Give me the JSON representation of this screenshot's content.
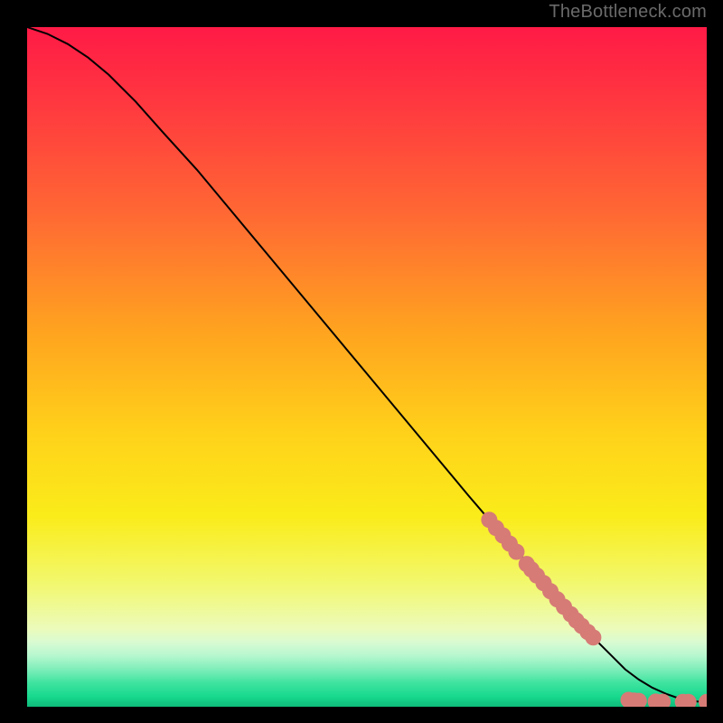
{
  "attribution": "TheBottleneck.com",
  "chart_data": {
    "type": "line",
    "title": "",
    "xlabel": "",
    "ylabel": "",
    "xlim": [
      0,
      100
    ],
    "ylim": [
      0,
      100
    ],
    "grid": false,
    "legend": false,
    "series": [
      {
        "name": "curve",
        "style": "line",
        "color": "#000000",
        "x": [
          0,
          3,
          6,
          9,
          12,
          16,
          20,
          25,
          30,
          35,
          40,
          45,
          50,
          55,
          60,
          65,
          68,
          72,
          76,
          80,
          83,
          86,
          88,
          90,
          92,
          94,
          96,
          98,
          100
        ],
        "y": [
          100,
          99,
          97.5,
          95.5,
          93,
          89,
          84.5,
          79,
          73,
          67,
          61,
          55,
          49,
          43,
          37,
          31,
          27.5,
          23,
          18.5,
          14,
          10.5,
          7.5,
          5.5,
          4,
          2.8,
          1.9,
          1.2,
          0.8,
          0.7
        ]
      },
      {
        "name": "upper-marker-cluster",
        "style": "points",
        "color": "#d67b76",
        "x": [
          68.0,
          69.0,
          70.0,
          71.0,
          72.0,
          73.5,
          74.2,
          75.0,
          76.0,
          77.0,
          78.0,
          79.0,
          80.0,
          80.8,
          81.6,
          82.5,
          83.3
        ],
        "y": [
          27.5,
          26.3,
          25.2,
          24.0,
          22.8,
          21.0,
          20.2,
          19.3,
          18.2,
          17.0,
          15.8,
          14.7,
          13.6,
          12.7,
          11.9,
          11.0,
          10.2
        ]
      },
      {
        "name": "lower-marker-cluster",
        "style": "points",
        "color": "#d67b76",
        "x": [
          88.5,
          89.3,
          90.0,
          92.5,
          93.5,
          96.5,
          97.3,
          100.0
        ],
        "y": [
          1.0,
          0.9,
          0.85,
          0.75,
          0.72,
          0.7,
          0.7,
          0.7
        ]
      }
    ],
    "background_gradient": {
      "stops": [
        {
          "offset": 0.0,
          "color": "#ff1a46"
        },
        {
          "offset": 0.12,
          "color": "#ff3a3f"
        },
        {
          "offset": 0.28,
          "color": "#ff6a33"
        },
        {
          "offset": 0.45,
          "color": "#ffa41f"
        },
        {
          "offset": 0.6,
          "color": "#ffd21a"
        },
        {
          "offset": 0.72,
          "color": "#faec1a"
        },
        {
          "offset": 0.82,
          "color": "#f2f86f"
        },
        {
          "offset": 0.885,
          "color": "#ecfbba"
        },
        {
          "offset": 0.905,
          "color": "#d9fbd2"
        },
        {
          "offset": 0.925,
          "color": "#b6f7cf"
        },
        {
          "offset": 0.945,
          "color": "#7eeeb9"
        },
        {
          "offset": 0.965,
          "color": "#3fe3a0"
        },
        {
          "offset": 0.985,
          "color": "#17d98e"
        },
        {
          "offset": 1.0,
          "color": "#0fba7a"
        }
      ]
    }
  }
}
